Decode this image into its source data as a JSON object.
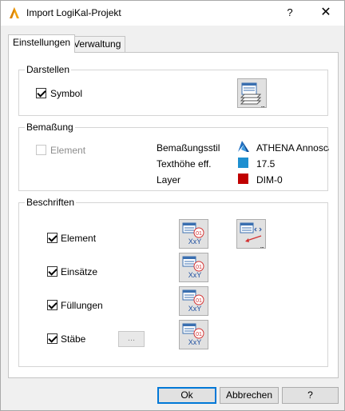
{
  "window": {
    "title": "Import LogiKal-Projekt",
    "help_glyph": "?",
    "close_glyph": "✕"
  },
  "tabs": [
    {
      "label": "Einstellungen",
      "active": true
    },
    {
      "label": "Verwaltung",
      "active": false
    }
  ],
  "darstellen": {
    "title": "Darstellen",
    "symbol_label": "Symbol",
    "symbol_checked": true,
    "dots": "..."
  },
  "bemassung": {
    "title": "Bemaßung",
    "element_label": "Element",
    "element_checked": false,
    "element_disabled": true,
    "rows": [
      {
        "label": "Bemaßungsstil",
        "value": "ATHENA Annoscale",
        "icon": "dimension-style-icon"
      },
      {
        "label": "Texthöhe eff.",
        "value": "17.5",
        "color": "#1e8fd0"
      },
      {
        "label": "Layer",
        "value": "DIM-0",
        "color": "#c00000"
      }
    ]
  },
  "beschriften": {
    "title": "Beschriften",
    "items": [
      {
        "label": "Element",
        "checked": true
      },
      {
        "label": "Einsätze",
        "checked": true
      },
      {
        "label": "Füllungen",
        "checked": true
      },
      {
        "label": "Stäbe",
        "checked": true
      }
    ],
    "stabe_more": "...",
    "label_icon_text": "01",
    "label_icon_sub": "XxY"
  },
  "buttons": {
    "ok": "Ok",
    "cancel": "Abbrechen",
    "help": "?"
  }
}
